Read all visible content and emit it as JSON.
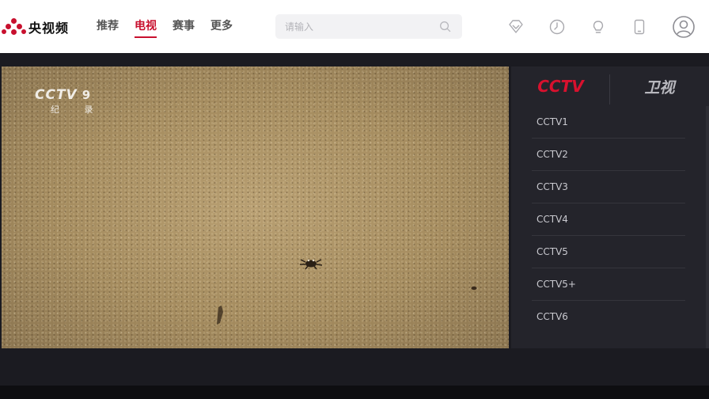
{
  "brand": {
    "name": "央视频",
    "color": "#c8102e"
  },
  "nav": {
    "items": [
      {
        "label": "推荐",
        "active": false
      },
      {
        "label": "电视",
        "active": true
      },
      {
        "label": "赛事",
        "active": false
      },
      {
        "label": "更多",
        "active": false
      }
    ]
  },
  "search": {
    "placeholder": "请输入",
    "value": ""
  },
  "toolbar": {
    "icons": [
      "vip-diamond-icon",
      "history-clock-icon",
      "lightbulb-icon",
      "phone-icon",
      "user-avatar-icon"
    ]
  },
  "player": {
    "channel_logo": {
      "brand": "CCTV",
      "number": "9",
      "sub": "纪 录"
    }
  },
  "panel": {
    "tabs": [
      {
        "label": "CCTV",
        "active": true
      },
      {
        "label": "卫视",
        "active": false
      }
    ],
    "channels": [
      "CCTV1",
      "CCTV2",
      "CCTV3",
      "CCTV4",
      "CCTV5",
      "CCTV5+",
      "CCTV6"
    ]
  },
  "colors": {
    "accent": "#c8102e",
    "panel_bg": "#24242b",
    "page_bg": "#1b1b21"
  }
}
